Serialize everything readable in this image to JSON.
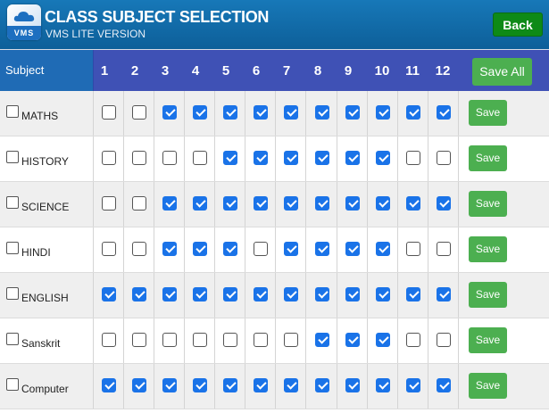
{
  "header": {
    "logo_text": "VMS",
    "title": "CLASS SUBJECT SELECTION",
    "subtitle": "VMS LITE VERSION",
    "back_label": "Back"
  },
  "table": {
    "subject_header": "Subject",
    "class_headers": [
      "1",
      "2",
      "3",
      "4",
      "5",
      "6",
      "7",
      "8",
      "9",
      "10",
      "11",
      "12"
    ],
    "save_all_label": "Save All",
    "save_label": "Save",
    "rows": [
      {
        "subject": "MATHS",
        "selected": false,
        "classes": [
          false,
          false,
          true,
          true,
          true,
          true,
          true,
          true,
          true,
          true,
          true,
          true
        ]
      },
      {
        "subject": "HISTORY",
        "selected": false,
        "classes": [
          false,
          false,
          false,
          false,
          true,
          true,
          true,
          true,
          true,
          true,
          false,
          false
        ]
      },
      {
        "subject": "SCIENCE",
        "selected": false,
        "classes": [
          false,
          false,
          true,
          true,
          true,
          true,
          true,
          true,
          true,
          true,
          true,
          true
        ]
      },
      {
        "subject": "HINDI",
        "selected": false,
        "classes": [
          false,
          false,
          true,
          true,
          true,
          false,
          true,
          true,
          true,
          true,
          false,
          false
        ]
      },
      {
        "subject": "ENGLISH",
        "selected": false,
        "classes": [
          true,
          true,
          true,
          true,
          true,
          true,
          true,
          true,
          true,
          true,
          true,
          true
        ]
      },
      {
        "subject": "Sanskrit",
        "selected": false,
        "classes": [
          false,
          false,
          false,
          false,
          false,
          false,
          false,
          true,
          true,
          true,
          false,
          false
        ]
      },
      {
        "subject": "Computer",
        "selected": false,
        "classes": [
          true,
          true,
          true,
          true,
          true,
          true,
          true,
          true,
          true,
          true,
          true,
          true
        ]
      }
    ]
  },
  "colors": {
    "header_bg": "#1570b0",
    "table_header_bg": "#3f51b5",
    "subject_header_bg": "#1f6bb5",
    "button_green": "#4caf50",
    "back_button_green": "#0e8a17",
    "checkbox_checked": "#1a73e8"
  }
}
